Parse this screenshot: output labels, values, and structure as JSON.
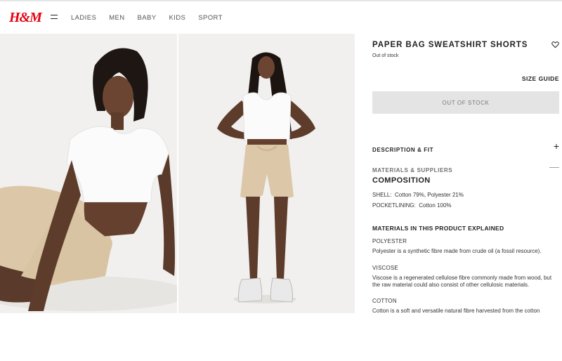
{
  "brand": {
    "logo_text": "H&M",
    "brand_color": "#e50010"
  },
  "nav": {
    "items": [
      "LADIES",
      "MEN",
      "BABY",
      "KIDS",
      "SPORT"
    ]
  },
  "icons": {
    "menu": "hamburger-icon",
    "wishlist": "heart-icon",
    "expand": "plus-icon",
    "collapse": "minus-icon"
  },
  "product": {
    "title": "PAPER BAG SWEATSHIRT SHORTS",
    "stock_status": "Out of stock",
    "size_guide": "SIZE GUIDE",
    "cta_label": "OUT OF STOCK"
  },
  "accordion": {
    "description": {
      "label": "DESCRIPTION & FIT",
      "sign": "+"
    },
    "materials": {
      "label": "MATERIALS & SUPPLIERS",
      "sign": "—"
    }
  },
  "composition": {
    "heading": "COMPOSITION",
    "lines": [
      {
        "part": "SHELL:",
        "value": "Cotton 79%, Polyester 21%"
      },
      {
        "part": "POCKETLINING:",
        "value": "Cotton 100%"
      }
    ]
  },
  "materials_explained": {
    "heading": "MATERIALS IN THIS PRODUCT EXPLAINED",
    "items": [
      {
        "name": "POLYESTER",
        "description": "Polyester is a synthetic fibre made from crude oil (a fossil resource)."
      },
      {
        "name": "VISCOSE",
        "description": "Viscose is a regenerated cellulose fibre commonly made from wood, but the raw material could also consist of other cellulosic materials."
      },
      {
        "name": "COTTON",
        "description": "Cotton is a soft and versatile natural fibre harvested from the cotton"
      }
    ]
  }
}
